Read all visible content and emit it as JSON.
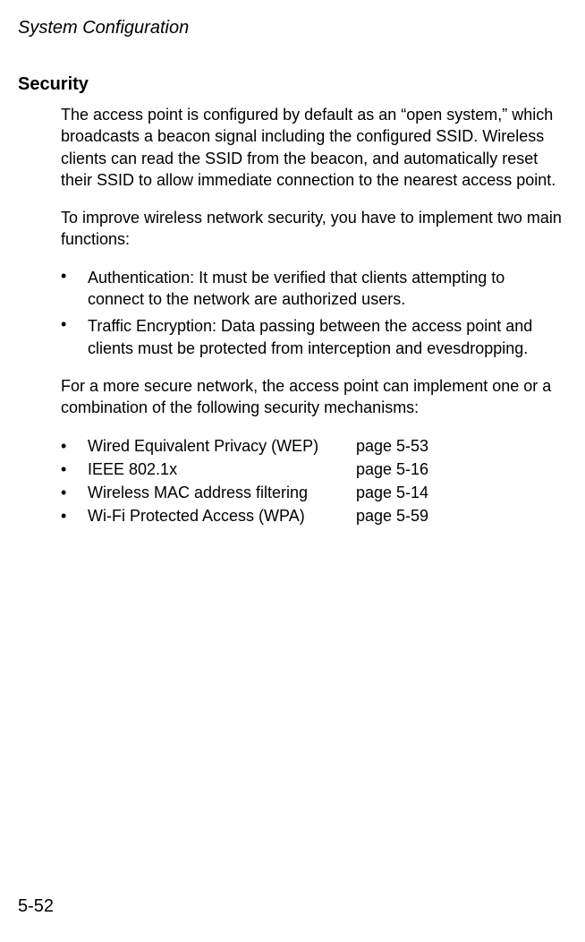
{
  "header": {
    "title": "System Configuration"
  },
  "section": {
    "heading": "Security",
    "intro": "The access point is configured by default as an “open system,” which broadcasts a beacon signal including the configured SSID. Wireless clients can read the SSID from the beacon, and automatically reset their SSID to allow immediate connection to the nearest access point.",
    "improve_text": "To improve wireless network security, you have to implement two main functions:",
    "functions": [
      "Authentication: It must be verified that clients attempting to connect to the network are authorized users.",
      "Traffic Encryption: Data passing between the access point and clients must be protected from interception and evesdropping."
    ],
    "mechanisms_intro": "For a more secure network, the access point can implement one or a combination of the following security mechanisms:",
    "mechanisms": [
      {
        "name": "Wired Equivalent Privacy (WEP)",
        "page": "page 5-53"
      },
      {
        "name": "IEEE 802.1x",
        "page": "page 5-16"
      },
      {
        "name": "Wireless MAC address filtering",
        "page": "page 5-14"
      },
      {
        "name": "Wi-Fi Protected Access (WPA)",
        "page": "page 5-59"
      }
    ]
  },
  "footer": {
    "page_number": "5-52"
  },
  "bullet_char": "•"
}
